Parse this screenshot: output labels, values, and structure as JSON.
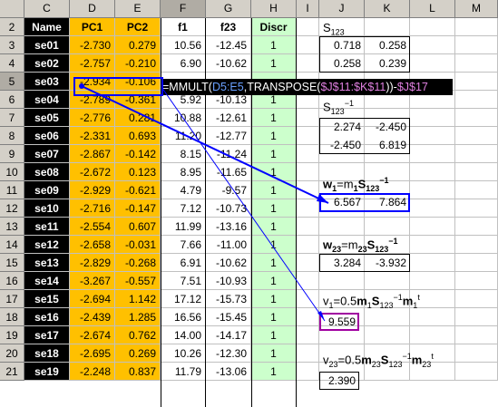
{
  "columns": [
    "C",
    "D",
    "E",
    "F",
    "G",
    "H",
    "I",
    "J",
    "K",
    "L",
    "M"
  ],
  "headers": {
    "name": "Name",
    "pc1": "PC1",
    "pc2": "PC2",
    "f1": "f1",
    "f23": "f23",
    "discr": "Discr"
  },
  "row_numbers": [
    "2",
    "3",
    "4",
    "5",
    "6",
    "7",
    "8",
    "9",
    "10",
    "11",
    "12",
    "13",
    "14",
    "15",
    "16",
    "17",
    "18",
    "19",
    "20",
    "21"
  ],
  "rows": [
    {
      "name": "se01",
      "pc1": "-2.730",
      "pc2": "0.279",
      "f1": "10.56",
      "f23": "-12.45",
      "discr": "1"
    },
    {
      "name": "se02",
      "pc1": "-2.757",
      "pc2": "-0.210",
      "f1": "6.90",
      "f23": "-10.62",
      "discr": "1"
    },
    {
      "name": "se03",
      "pc1": "-2.934",
      "pc2": "-0.106",
      "f1": "",
      "f23": "",
      "discr": ""
    },
    {
      "name": "se04",
      "pc1": "-2.789",
      "pc2": "-0.361",
      "f1": "5.92",
      "f23": "-10.13",
      "discr": "1"
    },
    {
      "name": "se05",
      "pc1": "-2.776",
      "pc2": "0.281",
      "f1": "10.88",
      "f23": "-12.61",
      "discr": "1"
    },
    {
      "name": "se06",
      "pc1": "-2.331",
      "pc2": "0.693",
      "f1": "11.20",
      "f23": "-12.77",
      "discr": "1"
    },
    {
      "name": "se07",
      "pc1": "-2.867",
      "pc2": "-0.142",
      "f1": "8.15",
      "f23": "-11.24",
      "discr": "1"
    },
    {
      "name": "se08",
      "pc1": "-2.672",
      "pc2": "0.123",
      "f1": "8.95",
      "f23": "-11.65",
      "discr": "1"
    },
    {
      "name": "se09",
      "pc1": "-2.929",
      "pc2": "-0.621",
      "f1": "4.79",
      "f23": "-9.57",
      "discr": "1"
    },
    {
      "name": "se10",
      "pc1": "-2.716",
      "pc2": "-0.147",
      "f1": "7.12",
      "f23": "-10.73",
      "discr": "1"
    },
    {
      "name": "se11",
      "pc1": "-2.554",
      "pc2": "0.607",
      "f1": "11.99",
      "f23": "-13.16",
      "discr": "1"
    },
    {
      "name": "se12",
      "pc1": "-2.658",
      "pc2": "-0.031",
      "f1": "7.66",
      "f23": "-11.00",
      "discr": "1"
    },
    {
      "name": "se13",
      "pc1": "-2.829",
      "pc2": "-0.268",
      "f1": "6.91",
      "f23": "-10.62",
      "discr": "1"
    },
    {
      "name": "se14",
      "pc1": "-3.267",
      "pc2": "-0.557",
      "f1": "7.51",
      "f23": "-10.93",
      "discr": "1"
    },
    {
      "name": "se15",
      "pc1": "-2.694",
      "pc2": "1.142",
      "f1": "17.12",
      "f23": "-15.73",
      "discr": "1"
    },
    {
      "name": "se16",
      "pc1": "-2.439",
      "pc2": "1.285",
      "f1": "16.56",
      "f23": "-15.45",
      "discr": "1"
    },
    {
      "name": "se17",
      "pc1": "-2.674",
      "pc2": "0.762",
      "f1": "14.00",
      "f23": "-14.17",
      "discr": "1"
    },
    {
      "name": "se18",
      "pc1": "-2.695",
      "pc2": "0.269",
      "f1": "10.26",
      "f23": "-12.30",
      "discr": "1"
    },
    {
      "name": "se19",
      "pc1": "-2.248",
      "pc2": "0.837",
      "f1": "11.79",
      "f23": "-13.06",
      "discr": "1"
    }
  ],
  "formula": {
    "prefix": "=MMULT(",
    "r1": "D5:E5",
    "mid": ",TRANSPOSE(",
    "r2": "$J$11:$K$11",
    "mid2": "))-",
    "r3": "$J$17"
  },
  "s123": {
    "label_main": "S",
    "label_sub": "123",
    "r1": [
      "0.718",
      "0.258"
    ],
    "r2": [
      "0.258",
      "0.239"
    ]
  },
  "s123inv": {
    "label_main": "S",
    "label_sub": "123",
    "label_sup": "−1",
    "r1": [
      "2.274",
      "-2.450"
    ],
    "r2": [
      "-2.450",
      "6.819"
    ]
  },
  "w1": {
    "a": "w",
    "a_sub": "1",
    "eq": "=m",
    "b_sub": "1",
    "c": "S",
    "c_sub": "123",
    "c_sup": "−1",
    "vals": [
      "6.567",
      "7.864"
    ]
  },
  "w23": {
    "a": "w",
    "a_sub": "23",
    "eq": "=m",
    "b_sub": "23",
    "c": "S",
    "c_sub": "123",
    "c_sup": "−1",
    "vals": [
      "3.284",
      "-3.932"
    ]
  },
  "v1": {
    "a": "v",
    "a_sub": "1",
    "eq": "=0.5",
    "m": "m",
    "m_sub": "1",
    "c": "S",
    "c_sub": "123",
    "c_sup": "−1",
    "d": "m",
    "d_sub": "1",
    "d_sup": "t",
    "val": "9.559"
  },
  "v23": {
    "a": "v",
    "a_sub": "23",
    "eq": "=0.5",
    "m": "m",
    "m_sub": "23",
    "c": "S",
    "c_sub": "123",
    "c_sup": "−1",
    "d": "m",
    "d_sub": "23",
    "d_sup": "t",
    "val": "2.390"
  },
  "colors": {
    "name_bg": "#000000",
    "name_text": "#d80000",
    "pc_bg": "#ffc000",
    "discr_bg": "#ccffcc",
    "trace": "#0000ff"
  }
}
